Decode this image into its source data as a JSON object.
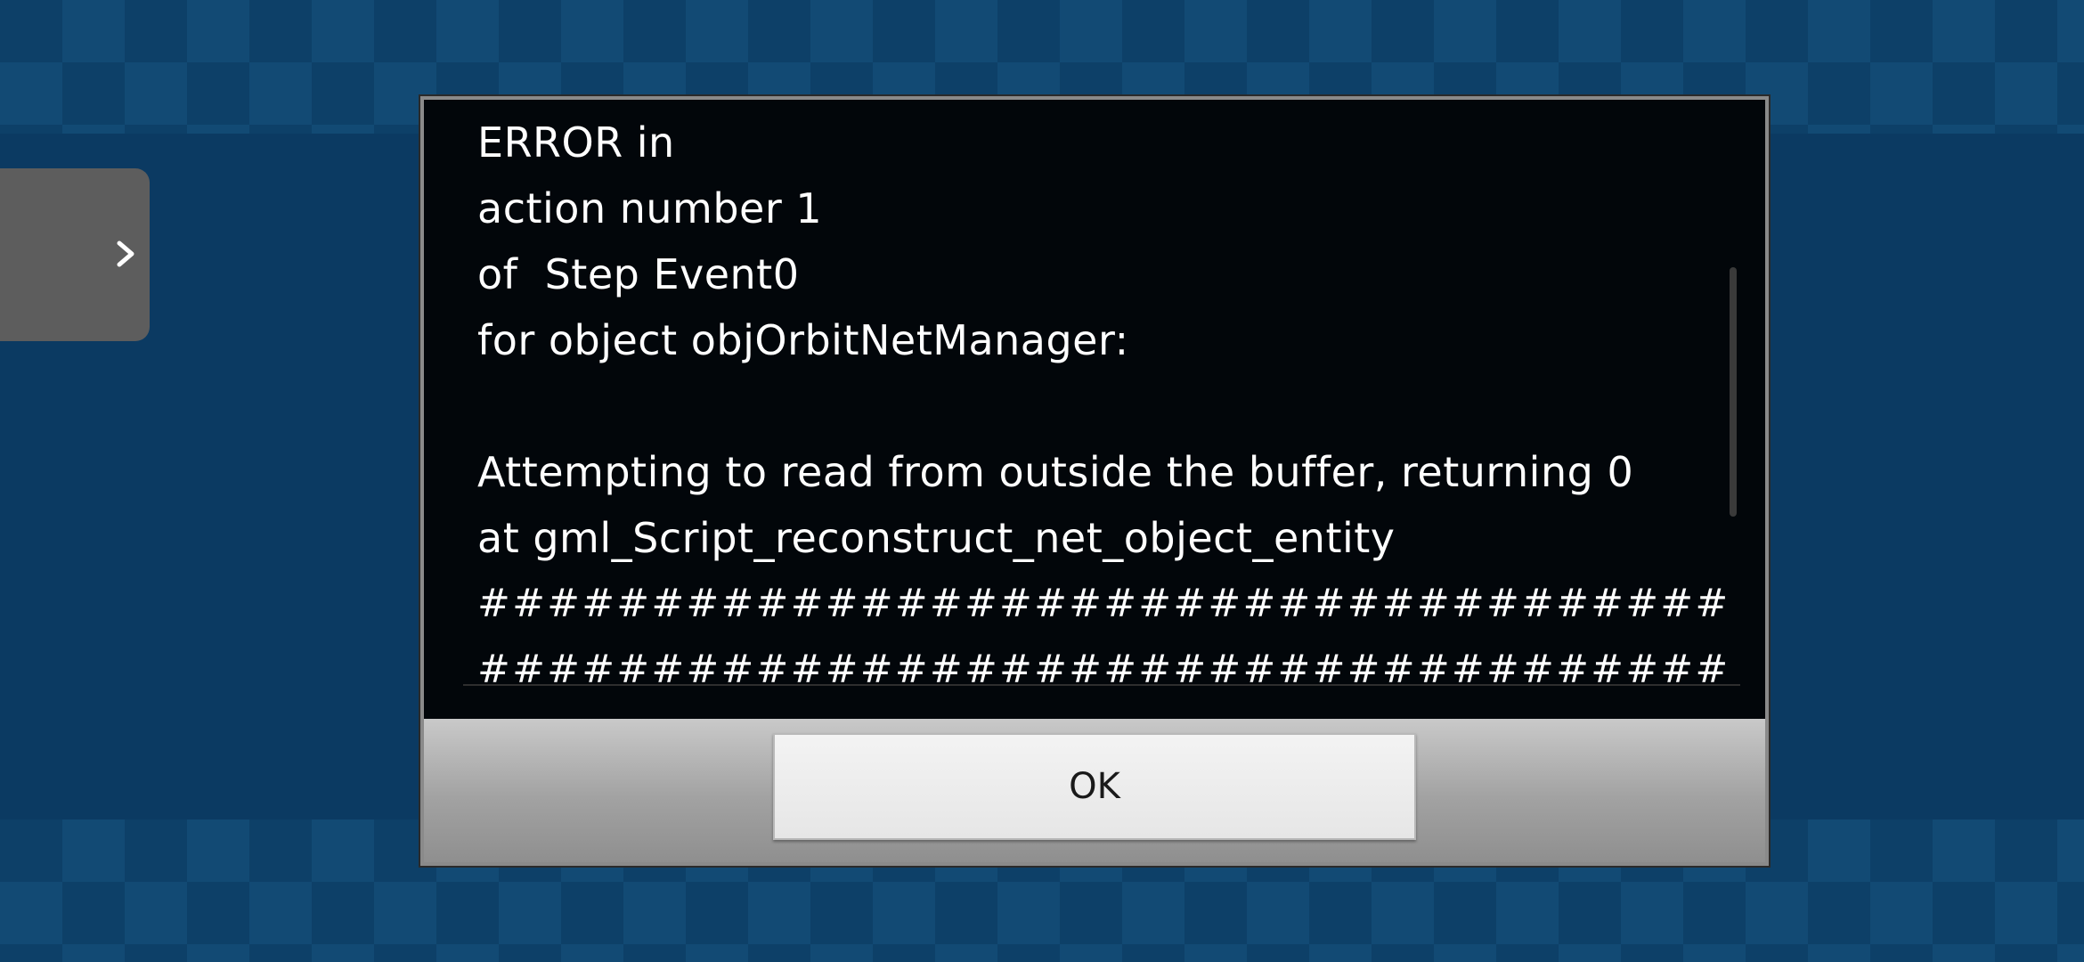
{
  "background": {
    "color": "#0b3a62",
    "checker_light": "#124a74"
  },
  "side_drawer": {
    "icon": "chevron-right-icon"
  },
  "error_dialog": {
    "lines": [
      "ERROR in",
      "action number 1",
      "of  Step Event0",
      "for object objOrbitNetManager:",
      "",
      "Attempting to read from outside the buffer, returning 0",
      "at gml_Script_reconstruct_net_object_entity",
      "####################################",
      "####################################"
    ],
    "ok_label": "OK"
  }
}
